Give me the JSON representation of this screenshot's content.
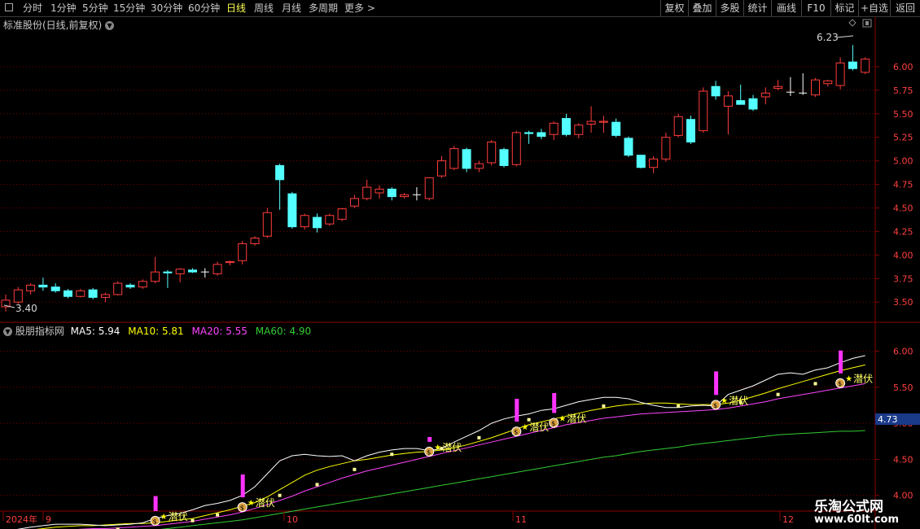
{
  "toolbar": {
    "periods": [
      "分时",
      "1分钟",
      "5分钟",
      "15分钟",
      "30分钟",
      "60分钟",
      "日线",
      "周线",
      "月线",
      "多周期",
      "更多 >"
    ],
    "active_period": "日线",
    "buttons": [
      "复权",
      "叠加",
      "多股",
      "统计",
      "画线",
      "F10",
      "标记",
      "+自选",
      "返回"
    ]
  },
  "main_chart": {
    "title": "标准股份(日线,前复权)",
    "y_ticks": [
      "6.00",
      "5.75",
      "5.50",
      "5.25",
      "5.00",
      "4.75",
      "4.50",
      "4.25",
      "4.00",
      "3.75",
      "3.50"
    ],
    "max_label": "6.23",
    "min_label": "3.40",
    "up_color": "#ff3c3c",
    "down_color": "#54ffff"
  },
  "indicator": {
    "title": "股朋指标网",
    "ma5_label": "MA5: 5.94",
    "ma10_label": "MA10: 5.81",
    "ma20_label": "MA20: 5.55",
    "ma60_label": "MA60: 4.90",
    "y_ticks": [
      "6.00",
      "5.50",
      "5.00",
      "4.50",
      "4.00"
    ],
    "current_value": "4.73",
    "signal_text": "潜伏",
    "ma5_color": "#ffffff",
    "ma10_color": "#ffff00",
    "ma20_color": "#ff44ff",
    "ma60_color": "#33cc33"
  },
  "date_axis": {
    "labels": [
      "2024年",
      "9",
      "10",
      "11",
      "12"
    ]
  },
  "watermark": {
    "title": "乐淘公式网",
    "url": "www.60lt.com"
  },
  "chart_data": {
    "type": "candlestick",
    "title": "标准股份(日线,前复权)",
    "ylim": [
      3.32,
      6.38
    ],
    "ohlc": [
      [
        3.45,
        3.58,
        3.4,
        3.52
      ],
      [
        3.5,
        3.66,
        3.48,
        3.63
      ],
      [
        3.62,
        3.7,
        3.58,
        3.68
      ],
      [
        3.68,
        3.76,
        3.62,
        3.66
      ],
      [
        3.66,
        3.7,
        3.6,
        3.62
      ],
      [
        3.62,
        3.64,
        3.54,
        3.56
      ],
      [
        3.56,
        3.64,
        3.55,
        3.62
      ],
      [
        3.63,
        3.65,
        3.53,
        3.55
      ],
      [
        3.55,
        3.6,
        3.5,
        3.58
      ],
      [
        3.58,
        3.72,
        3.57,
        3.7
      ],
      [
        3.68,
        3.7,
        3.64,
        3.66
      ],
      [
        3.66,
        3.74,
        3.64,
        3.72
      ],
      [
        3.72,
        3.98,
        3.7,
        3.82
      ],
      [
        3.82,
        3.84,
        3.65,
        3.81
      ],
      [
        3.8,
        3.86,
        3.71,
        3.85
      ],
      [
        3.84,
        3.86,
        3.81,
        3.82
      ],
      [
        3.82,
        3.86,
        3.76,
        3.82
      ],
      [
        3.8,
        3.93,
        3.78,
        3.9
      ],
      [
        3.92,
        3.94,
        3.89,
        3.93
      ],
      [
        3.94,
        4.15,
        3.9,
        4.12
      ],
      [
        4.12,
        4.2,
        4.1,
        4.18
      ],
      [
        4.2,
        4.5,
        4.18,
        4.45
      ],
      [
        4.95,
        4.97,
        4.48,
        4.8
      ],
      [
        4.65,
        4.67,
        4.28,
        4.3
      ],
      [
        4.3,
        4.44,
        4.27,
        4.42
      ],
      [
        4.4,
        4.44,
        4.24,
        4.29
      ],
      [
        4.33,
        4.44,
        4.31,
        4.42
      ],
      [
        4.38,
        4.5,
        4.36,
        4.49
      ],
      [
        4.52,
        4.64,
        4.5,
        4.6
      ],
      [
        4.6,
        4.8,
        4.58,
        4.72
      ],
      [
        4.66,
        4.74,
        4.6,
        4.7
      ],
      [
        4.7,
        4.72,
        4.58,
        4.62
      ],
      [
        4.62,
        4.66,
        4.6,
        4.64
      ],
      [
        4.64,
        4.72,
        4.58,
        4.64
      ],
      [
        4.6,
        4.82,
        4.58,
        4.82
      ],
      [
        4.84,
        5.05,
        4.82,
        5.0
      ],
      [
        4.92,
        5.16,
        4.9,
        5.13
      ],
      [
        5.12,
        5.14,
        4.88,
        4.92
      ],
      [
        4.92,
        5.0,
        4.88,
        4.97
      ],
      [
        4.98,
        5.22,
        4.95,
        5.2
      ],
      [
        5.12,
        5.14,
        4.93,
        4.95
      ],
      [
        4.96,
        5.32,
        4.94,
        5.3
      ],
      [
        5.3,
        5.32,
        5.18,
        5.29
      ],
      [
        5.3,
        5.34,
        5.23,
        5.26
      ],
      [
        5.28,
        5.42,
        5.22,
        5.4
      ],
      [
        5.45,
        5.5,
        5.26,
        5.28
      ],
      [
        5.28,
        5.4,
        5.24,
        5.38
      ],
      [
        5.39,
        5.58,
        5.3,
        5.42
      ],
      [
        5.41,
        5.48,
        5.3,
        5.42
      ],
      [
        5.41,
        5.45,
        5.25,
        5.27
      ],
      [
        5.24,
        5.26,
        5.04,
        5.06
      ],
      [
        5.06,
        5.06,
        4.92,
        4.93
      ],
      [
        4.93,
        5.05,
        4.87,
        5.02
      ],
      [
        5.02,
        5.3,
        4.99,
        5.25
      ],
      [
        5.27,
        5.5,
        5.25,
        5.47
      ],
      [
        5.44,
        5.48,
        5.18,
        5.2
      ],
      [
        5.32,
        5.78,
        5.3,
        5.74
      ],
      [
        5.79,
        5.85,
        5.65,
        5.69
      ],
      [
        5.58,
        5.74,
        5.28,
        5.69
      ],
      [
        5.64,
        5.81,
        5.6,
        5.6
      ],
      [
        5.66,
        5.7,
        5.53,
        5.55
      ],
      [
        5.68,
        5.78,
        5.6,
        5.72
      ],
      [
        5.77,
        5.86,
        5.75,
        5.79
      ],
      [
        5.73,
        5.89,
        5.69,
        5.73
      ],
      [
        5.72,
        5.93,
        5.7,
        5.72
      ],
      [
        5.7,
        5.88,
        5.68,
        5.86
      ],
      [
        5.82,
        5.86,
        5.79,
        5.85
      ],
      [
        5.8,
        6.1,
        5.76,
        6.04
      ],
      [
        6.05,
        6.23,
        5.96,
        5.98
      ],
      [
        5.94,
        6.1,
        5.92,
        6.08
      ]
    ],
    "indicator_ylim": [
      3.85,
      6.3
    ],
    "ma5": [
      3.5,
      3.53,
      3.56,
      3.58,
      3.6,
      3.6,
      3.6,
      3.59,
      3.58,
      3.59,
      3.6,
      3.62,
      3.68,
      3.72,
      3.75,
      3.8,
      3.86,
      3.89,
      3.93,
      4.0,
      4.12,
      4.3,
      4.48,
      4.55,
      4.57,
      4.55,
      4.54,
      4.55,
      4.48,
      4.55,
      4.6,
      4.63,
      4.65,
      4.65,
      4.62,
      4.65,
      4.74,
      4.82,
      4.9,
      5.0,
      5.06,
      5.1,
      5.13,
      5.18,
      5.2,
      5.25,
      5.3,
      5.33,
      5.36,
      5.36,
      5.34,
      5.29,
      5.25,
      5.22,
      5.22,
      5.24,
      5.25,
      5.24,
      5.4,
      5.46,
      5.52,
      5.6,
      5.68,
      5.7,
      5.68,
      5.74,
      5.77,
      5.84,
      5.9,
      5.94
    ],
    "ma10": [
      3.48,
      3.5,
      3.52,
      3.54,
      3.56,
      3.57,
      3.58,
      3.58,
      3.59,
      3.6,
      3.61,
      3.61,
      3.62,
      3.64,
      3.66,
      3.68,
      3.72,
      3.76,
      3.8,
      3.85,
      3.9,
      3.98,
      4.08,
      4.18,
      4.28,
      4.35,
      4.4,
      4.44,
      4.48,
      4.5,
      4.53,
      4.56,
      4.58,
      4.6,
      4.61,
      4.63,
      4.66,
      4.7,
      4.75,
      4.8,
      4.86,
      4.92,
      4.98,
      5.02,
      5.06,
      5.1,
      5.14,
      5.18,
      5.21,
      5.24,
      5.26,
      5.27,
      5.28,
      5.28,
      5.27,
      5.26,
      5.26,
      5.26,
      5.28,
      5.32,
      5.37,
      5.42,
      5.48,
      5.53,
      5.58,
      5.63,
      5.68,
      5.73,
      5.77,
      5.81
    ],
    "ma20": [
      3.47,
      3.48,
      3.49,
      3.5,
      3.51,
      3.52,
      3.53,
      3.54,
      3.54,
      3.55,
      3.56,
      3.57,
      3.58,
      3.6,
      3.62,
      3.64,
      3.67,
      3.7,
      3.73,
      3.77,
      3.82,
      3.87,
      3.93,
      3.99,
      4.06,
      4.12,
      4.18,
      4.24,
      4.29,
      4.34,
      4.38,
      4.42,
      4.46,
      4.5,
      4.54,
      4.58,
      4.62,
      4.66,
      4.7,
      4.74,
      4.78,
      4.82,
      4.86,
      4.9,
      4.94,
      4.98,
      5.01,
      5.04,
      5.07,
      5.09,
      5.11,
      5.13,
      5.14,
      5.15,
      5.16,
      5.17,
      5.18,
      5.19,
      5.21,
      5.24,
      5.27,
      5.3,
      5.34,
      5.37,
      5.4,
      5.43,
      5.46,
      5.49,
      5.52,
      5.55
    ],
    "ma60": [
      3.41,
      3.42,
      3.42,
      3.43,
      3.44,
      3.45,
      3.46,
      3.47,
      3.48,
      3.49,
      3.5,
      3.51,
      3.52,
      3.54,
      3.56,
      3.58,
      3.6,
      3.62,
      3.64,
      3.66,
      3.69,
      3.72,
      3.75,
      3.78,
      3.81,
      3.84,
      3.87,
      3.9,
      3.93,
      3.96,
      3.99,
      4.02,
      4.05,
      4.08,
      4.11,
      4.14,
      4.17,
      4.2,
      4.23,
      4.26,
      4.29,
      4.32,
      4.35,
      4.38,
      4.41,
      4.44,
      4.47,
      4.5,
      4.53,
      4.55,
      4.58,
      4.61,
      4.63,
      4.65,
      4.67,
      4.7,
      4.72,
      4.74,
      4.76,
      4.78,
      4.8,
      4.82,
      4.84,
      4.85,
      4.86,
      4.87,
      4.88,
      4.89,
      4.89,
      4.9
    ],
    "signals": [
      {
        "index": 12,
        "bar_top": 3.99
      },
      {
        "index": 19,
        "bar_top": 4.29
      },
      {
        "index": 34,
        "bar_top": 4.81
      },
      {
        "index": 41,
        "bar_top": 5.34
      },
      {
        "index": 44,
        "bar_top": 5.42
      },
      {
        "index": 57,
        "bar_top": 5.72
      },
      {
        "index": 67,
        "bar_top": 6.01
      }
    ],
    "dots": [
      {
        "index": 3,
        "value": 3.47
      },
      {
        "index": 6,
        "value": 3.5
      },
      {
        "index": 9,
        "value": 3.53
      },
      {
        "index": 15,
        "value": 3.65
      },
      {
        "index": 17,
        "value": 3.73
      },
      {
        "index": 22,
        "value": 4.0
      },
      {
        "index": 25,
        "value": 4.15
      },
      {
        "index": 28,
        "value": 4.36
      },
      {
        "index": 31,
        "value": 4.57
      },
      {
        "index": 35,
        "value": 4.65
      },
      {
        "index": 38,
        "value": 4.8
      },
      {
        "index": 42,
        "value": 5.05
      },
      {
        "index": 48,
        "value": 5.24
      },
      {
        "index": 54,
        "value": 5.24
      },
      {
        "index": 59,
        "value": 5.29
      },
      {
        "index": 62,
        "value": 5.4
      },
      {
        "index": 65,
        "value": 5.55
      }
    ]
  }
}
